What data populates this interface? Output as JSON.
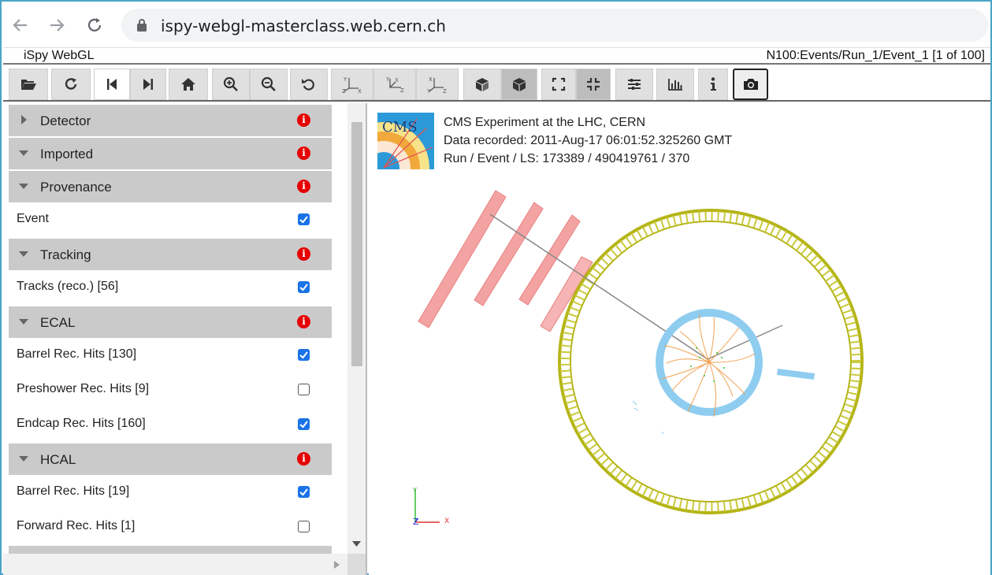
{
  "browser": {
    "url": "ispy-webgl-masterclass.web.cern.ch",
    "back_icon": "back-arrow-icon",
    "forward_icon": "forward-arrow-icon",
    "reload_icon": "reload-icon"
  },
  "app": {
    "title": "iSpy WebGL",
    "event_info": "N100:Events/Run_1/Event_1 [1 of 100]"
  },
  "toolbar": {
    "buttons": [
      "open-file-icon",
      "reload-icon",
      "first-event-icon",
      "next-event-icon",
      "home-icon",
      "zoom-in-icon",
      "zoom-out-icon",
      "reset-icon",
      "view-yz-icon",
      "view-xz-icon",
      "view-xy-icon",
      "perspective-icon",
      "orthographic-icon",
      "fullscreen-icon",
      "exit-fullscreen-icon",
      "settings-sliders-icon",
      "histogram-icon",
      "info-icon",
      "camera-icon"
    ]
  },
  "sidebar": {
    "groups": [
      {
        "label": "Detector",
        "expanded": false
      },
      {
        "label": "Imported",
        "expanded": true
      },
      {
        "label": "Provenance",
        "expanded": true
      },
      {
        "label": "Tracking",
        "expanded": true
      },
      {
        "label": "ECAL",
        "expanded": true
      },
      {
        "label": "HCAL",
        "expanded": true
      }
    ],
    "items": [
      {
        "label": "Event",
        "checked": true
      },
      {
        "label": "Tracks (reco.) [56]",
        "checked": true
      },
      {
        "label": "Barrel Rec. Hits [130]",
        "checked": true
      },
      {
        "label": "Preshower Rec. Hits [9]",
        "checked": false
      },
      {
        "label": "Endcap Rec. Hits [160]",
        "checked": true
      },
      {
        "label": "Barrel Rec. Hits [19]",
        "checked": true
      },
      {
        "label": "Forward Rec. Hits [1]",
        "checked": false
      }
    ]
  },
  "viewer": {
    "logo_text": "CMS",
    "caption_line1": "CMS Experiment at the LHC, CERN",
    "caption_line2": "Data recorded: 2011-Aug-17 06:01:52.325260 GMT",
    "caption_line3": "Run / Event / LS: 173389 / 490419761 / 370",
    "axes": {
      "y": "Y",
      "z": "Z",
      "x": "X"
    },
    "colors": {
      "muon_chamber": "#f4a3a3",
      "muon_outer_ring": "#b5b518",
      "ecal_ring": "#8ecdf0",
      "tracks": "#f0a050",
      "muon_track": "#888888"
    }
  }
}
